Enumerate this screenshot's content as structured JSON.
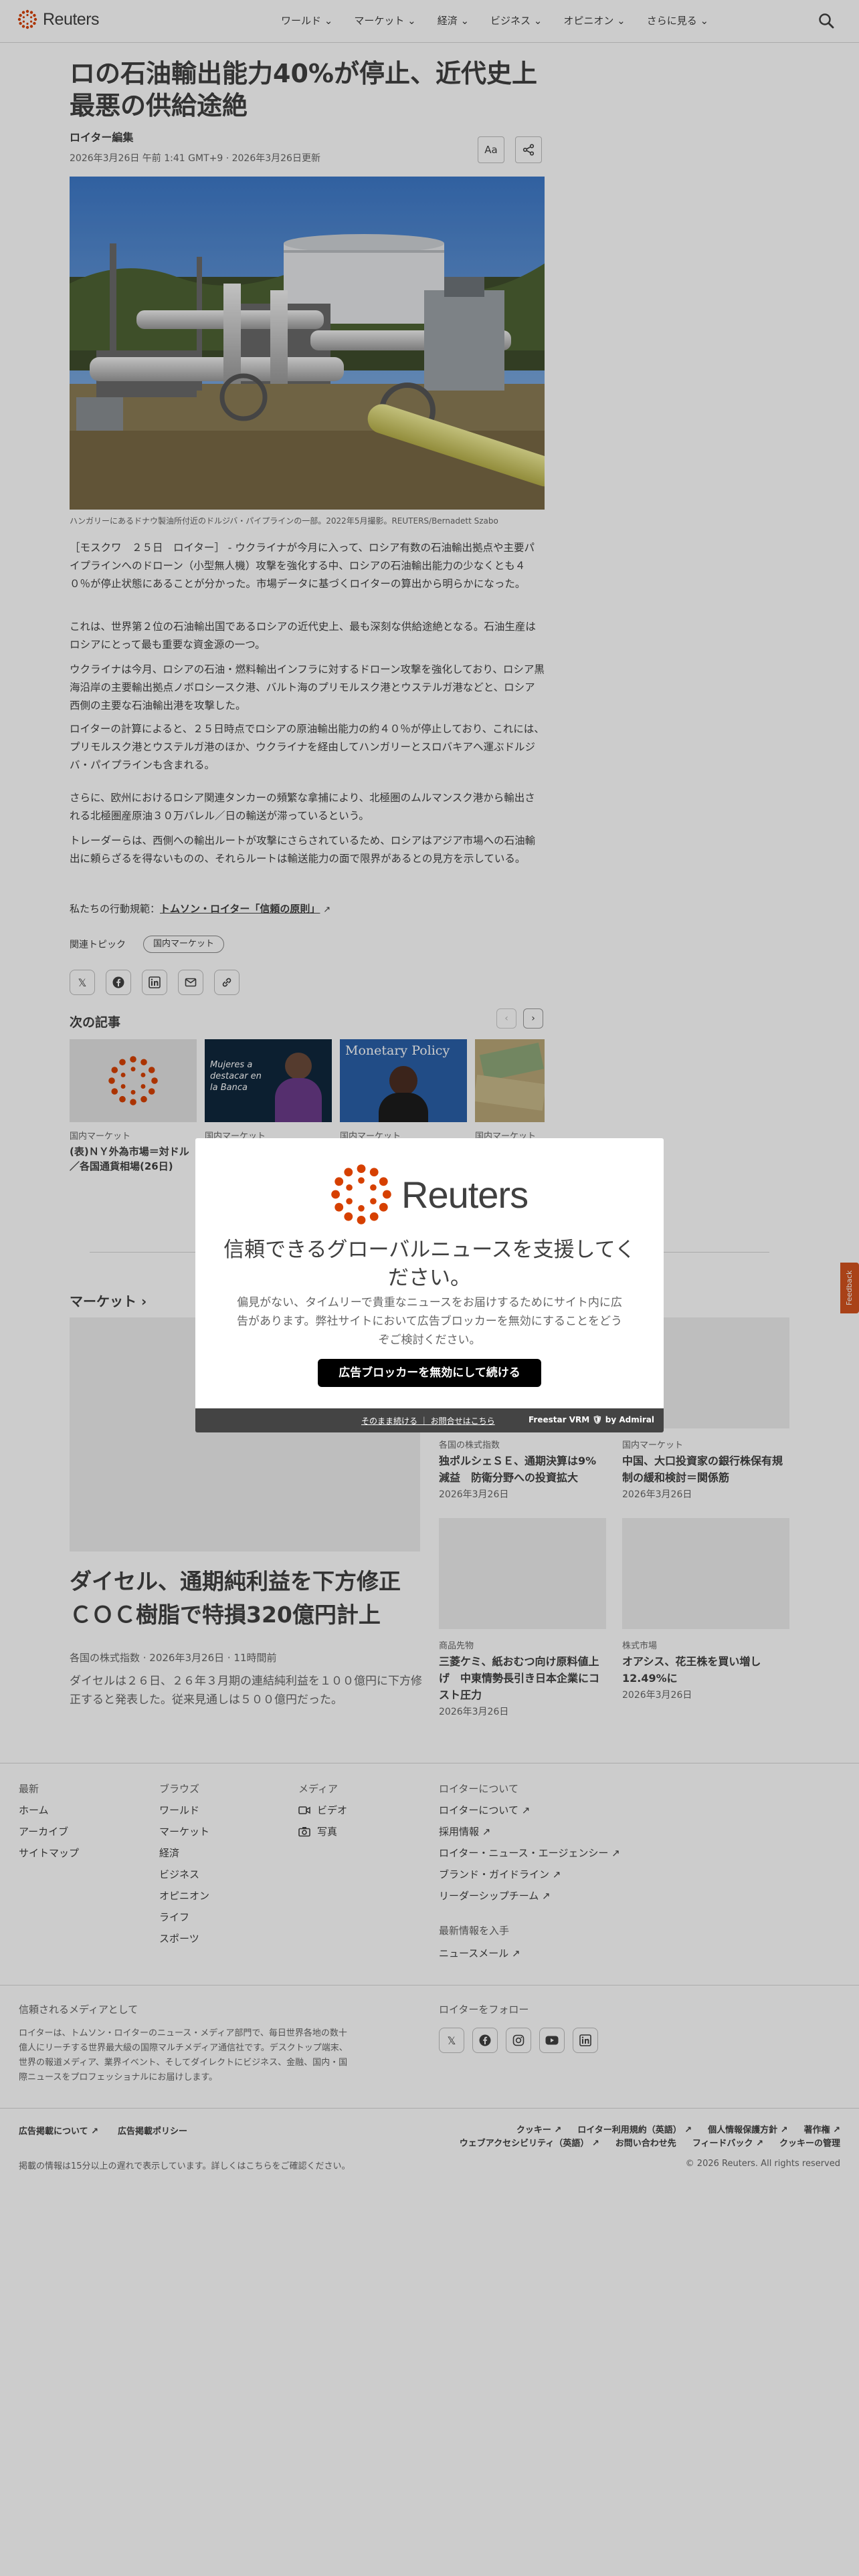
{
  "header": {
    "brand": "Reuters",
    "nav": [
      "ワールド ⌄",
      "マーケット ⌄",
      "経済 ⌄",
      "ビジネス ⌄",
      "オピニオン ⌄",
      "さらに見る ⌄"
    ]
  },
  "article": {
    "headline": "ロの石油輸出能力40%が停止、近代史上最悪の供給途絶",
    "byline": "ロイター編集",
    "dateline": "2026年3月26日 午前 1:41 GMT+9 · 2026年3月26日更新",
    "font_button": "Aa",
    "caption": "ハンガリーにあるドナウ製油所付近のドルジバ・パイプラインの一部。2022年5月撮影。REUTERS/Bernadett Szabo",
    "paragraphs": [
      "［モスクワ　２５日　ロイター］ - ウクライナが今月に入って、ロシア有数の石油輸出拠点や主要パイプラインへのドローン（小型無人機）攻撃を強化する中、ロシアの石油輸出能力の少なくとも４０％が停止状態にあることが分かった。市場データに基づくロイターの算出から明らかになった。",
      "これは、世界第２位の石油輸出国であるロシアの近代史上、最も深刻な供給途絶となる。石油生産はロシアにとって最も重要な資金源の一つ。",
      "ウクライナは今月、ロシアの石油・燃料輸出インフラに対するドローン攻撃を強化しており、ロシア黒海沿岸の主要輸出拠点ノボロシースク港、バルト海のプリモルスク港とウステルガ港などと、ロシア西側の主要な石油輸出港を攻撃した。",
      "ロイターの計算によると、２５日時点でロシアの原油輸出能力の約４０％が停止しており、これには、プリモルスク港とウステルガ港のほか、ウクライナを経由してハンガリーとスロバキアへ運ぶドルジバ・パイプラインも含まれる。",
      "さらに、欧州におけるロシア関連タンカーの頻繁な拿捕により、北極圏のムルマンスク港から輸出される北極圏産原油３０万バレル／日の輸送が滞っているという。",
      "トレーダーらは、西側への輸出ルートが攻撃にさらされているため、ロシアはアジア市場への石油輸出に頼らざるを得ないものの、それらルートは輸送能力の面で限界があるとの見方を示している。"
    ],
    "principles_prefix": "私たちの行動規範：",
    "principles_link": "トムソン・ロイター「信頼の原則」",
    "topics_label": "関連トピック",
    "topic": "国内マーケット"
  },
  "next": {
    "title": "次の記事",
    "cards": [
      {
        "tag": "国内マーケット",
        "title": "(表)ＮＹ外為市場＝対ドル／各国通貨相場(26日)"
      },
      {
        "tag": "国内マーケット",
        "title": ""
      },
      {
        "tag": "国内マーケット",
        "title": ""
      },
      {
        "tag": "国内マーケット",
        "title": ""
      }
    ],
    "card2_sign": "Mujeres a destacar en la Banca",
    "card3_sign": "Monetary Policy"
  },
  "markets": {
    "title": "マーケット ›",
    "lead": {
      "headline": "ダイセル、通期純利益を下方修正　ＣＯＣ樹脂で特損320億円計上",
      "meta": "各国の株式指数 · 2026年3月26日 · 11時間前",
      "desc": "ダイセルは２６日、２６年３月期の連結純利益を１００億円に下方修正すると発表した。従来見通しは５００億円だった。"
    },
    "grid": [
      {
        "tag": "各国の株式指数",
        "title": "独ポルシェＳＥ、通期決算は9%減益　防衛分野への投資拡大",
        "date": "2026年3月26日"
      },
      {
        "tag": "国内マーケット",
        "title": "中国、大口投資家の銀行株保有規制の緩和検討＝関係筋",
        "date": "2026年3月26日"
      },
      {
        "tag": "商品先物",
        "title": "三菱ケミ、紙おむつ向け原料値上げ　中東情勢長引き日本企業にコスト圧力",
        "date": "2026年3月26日"
      },
      {
        "tag": "株式市場",
        "title": "オアシス、花王株を買い増し12.49%に",
        "date": "2026年3月26日"
      }
    ]
  },
  "footer": {
    "col1": {
      "head": "最新",
      "links": [
        "ホーム",
        "アーカイブ",
        "サイトマップ"
      ]
    },
    "col2": {
      "head": "ブラウズ",
      "links": [
        "ワールド",
        "マーケット",
        "経済",
        "ビジネス",
        "オピニオン",
        "ライフ",
        "スポーツ"
      ]
    },
    "col3": {
      "head": "メディア",
      "links": [
        "ビデオ",
        "写真"
      ]
    },
    "col4": {
      "head": "ロイターについて",
      "links": [
        "ロイターについて ↗",
        "採用情報 ↗",
        "ロイター・ニュース・エージェンシー ↗",
        "ブランド・ガイドライン ↗",
        "リーダーシップチーム ↗"
      ]
    },
    "latest_head": "最新情報を入手",
    "newsletter": "ニュースメール ↗",
    "trusted_head": "信頼されるメディアとして",
    "trusted_text": "ロイターは、トムソン・ロイターのニュース・メディア部門で、毎日世界各地の数十億人にリーチする世界最大級の国際マルチメディア通信社です。デスクトップ端末、世界の報道メディア、業界イベント、そしてダイレクトにビジネス、金融、国内・国際ニュースをプロフェッショナルにお届けします。",
    "follow_head": "ロイターをフォロー",
    "ad1": "広告掲載について ↗",
    "ad2": "広告掲載ポリシー",
    "legal_row1": [
      "クッキー ↗",
      "ロイター利用規約（英語） ↗",
      "個人情報保護方針 ↗",
      "著作権 ↗"
    ],
    "legal_row2": [
      "ウェブアクセシビリティ（英語） ↗",
      "お問い合わせ先",
      "フィードバック ↗",
      "クッキーの管理"
    ],
    "delay": "掲載の情報は15分以上の遅れで表示しています。詳しくはこちらをご確認ください。",
    "copyright": "© 2026 Reuters. All rights reserved"
  },
  "modal": {
    "brand": "Reuters",
    "heading": "信頼できるグローバルニュースを支援してください。",
    "body": "偏見がない、タイムリーで貴重なニュースをお届けするためにサイト内に広告があります。弊社サイトにおいて広告ブロッカーを無効にすることをどうぞご検討ください。",
    "button": "広告ブロッカーを無効にして続ける",
    "footer_links": "そのまま続ける ｜ お問合せはこちら",
    "powered": "Freestar VRM 🛡 by Admiral"
  },
  "feedback": "Feedback",
  "colors": {
    "accent": "#d64000",
    "text": "#404040",
    "overlay": "rgba(0,0,0,0.2)"
  }
}
